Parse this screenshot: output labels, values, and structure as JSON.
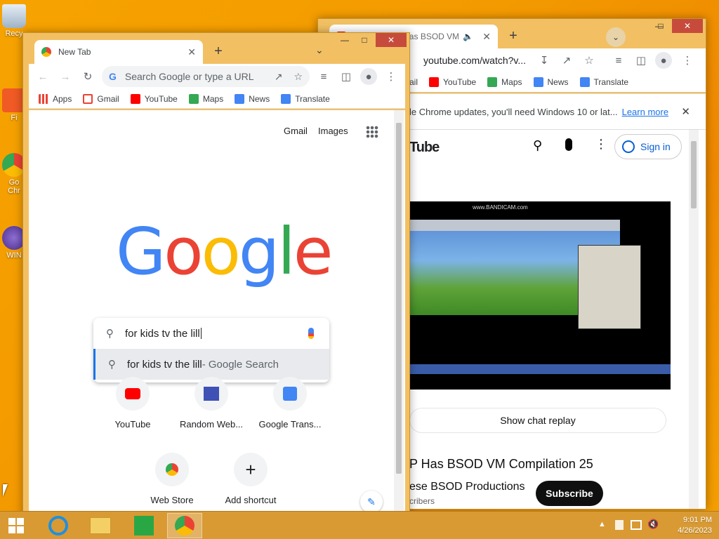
{
  "desktop": {
    "icons": [
      {
        "label": "Recy",
        "name": "recycle-bin"
      },
      {
        "label": "Fi",
        "name": "file-shortcut"
      },
      {
        "label": "Go\nChr",
        "name": "chrome-shortcut"
      },
      {
        "label": "WIN",
        "name": "win-shortcut"
      }
    ]
  },
  "window_left": {
    "tab_title": "New Tab",
    "new_tab_symbol": "+",
    "omnibox_placeholder": "Search Google or type a URL",
    "bookmarks": [
      "Apps",
      "Gmail",
      "YouTube",
      "Maps",
      "News",
      "Translate"
    ],
    "ntp": {
      "gmail_link": "Gmail",
      "images_link": "Images",
      "logo_letters": [
        "G",
        "o",
        "o",
        "g",
        "l",
        "e"
      ],
      "search_value": "for kids tv the lill",
      "suggestion_query": "for kids tv the lill",
      "suggestion_suffix": " - Google Search",
      "shortcuts": [
        {
          "label": "YouTube",
          "name": "youtube"
        },
        {
          "label": "Random Web...",
          "name": "random-web"
        },
        {
          "label": "Google Trans...",
          "name": "google-translate"
        },
        {
          "label": "Web Store",
          "name": "web-store"
        },
        {
          "label": "Add shortcut",
          "name": "add-shortcut"
        }
      ]
    }
  },
  "window_right": {
    "tab_title": "Windows XP Has BSOD VM",
    "address": "youtube.com/watch?v...",
    "bookmarks": [
      "ail",
      "YouTube",
      "Maps",
      "News",
      "Translate"
    ],
    "info_bar": {
      "text": "le Chrome updates, you'll need Windows 10 or lat...",
      "link": "Learn more"
    },
    "youtube": {
      "brand_partial": "Tube",
      "sign_in": "Sign in",
      "video_watermark": "www.BANDICAM.com",
      "chat_replay": "Show chat replay",
      "video_title": "P Has BSOD VM Compilation 25",
      "channel_name": "ese BSOD Productions",
      "subscribers": "cribers",
      "subscribe_button": "Subscribe"
    }
  },
  "taskbar": {
    "time": "9:01 PM",
    "date": "4/26/2023"
  },
  "colors": {
    "google_blue": "#4285f4",
    "google_red": "#ea4335",
    "google_yellow": "#fbbc05",
    "google_green": "#34a853",
    "youtube_red": "#ff0000",
    "link_blue": "#1a73e8",
    "desktop_orange": "#f39a00"
  }
}
